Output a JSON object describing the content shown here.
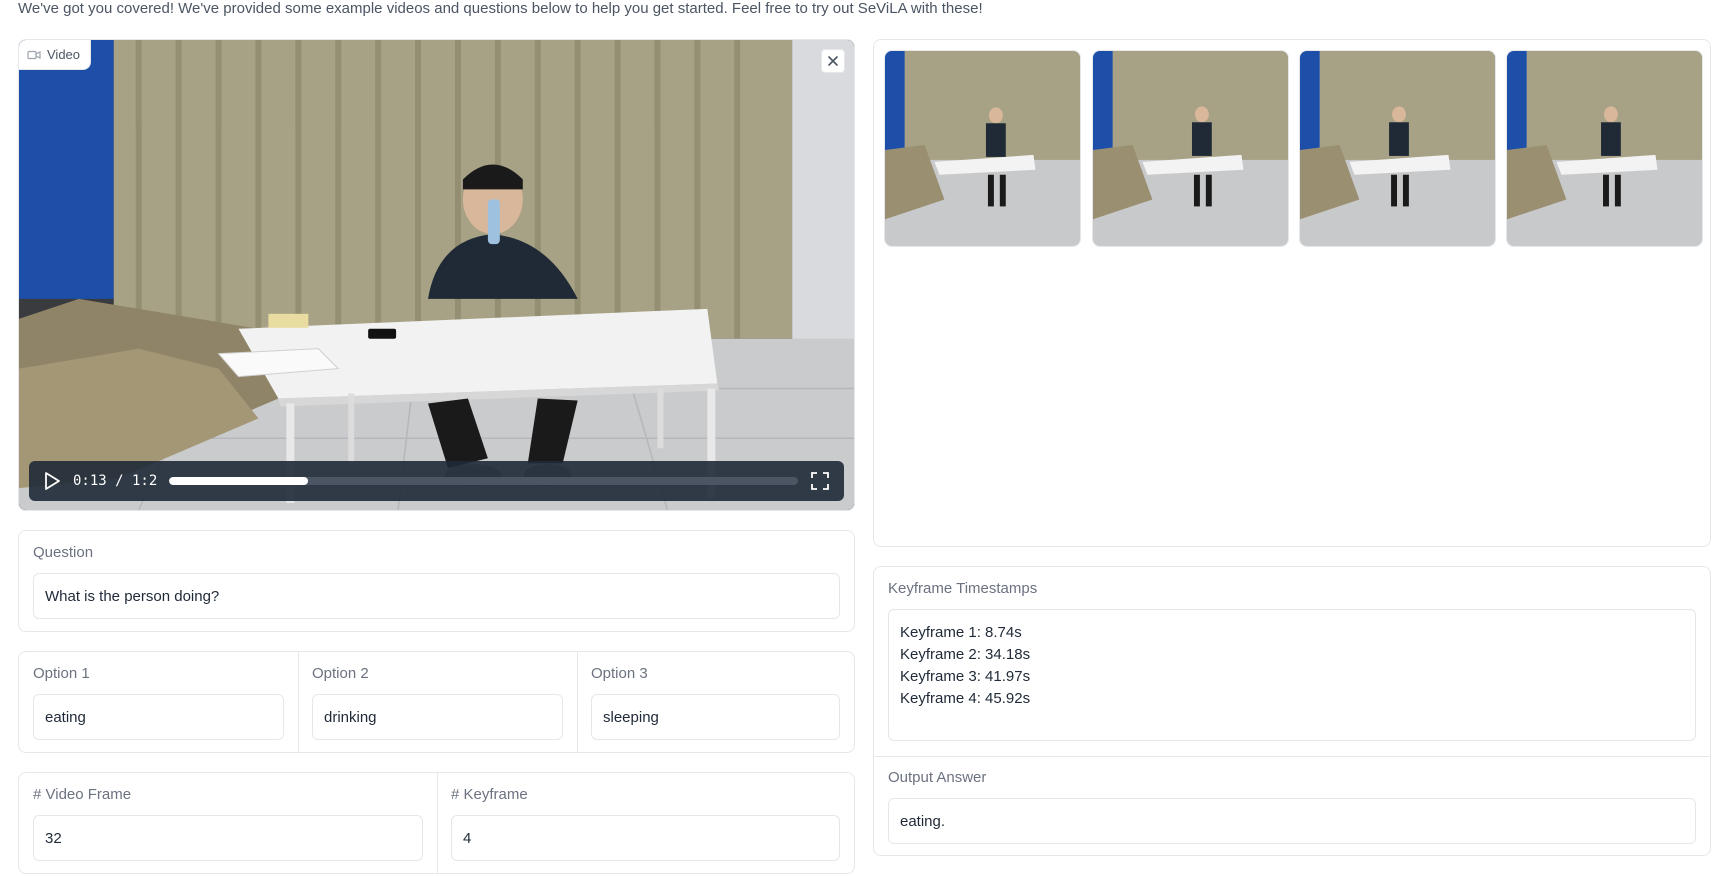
{
  "intro_text": "We've got you covered! We've provided some example videos and questions below to help you get started. Feel free to try out SeViLA with these!",
  "video": {
    "label": "Video",
    "time": "0:13 / 1:2",
    "progress_fraction": 0.22
  },
  "question": {
    "label": "Question",
    "value": "What is the person doing?"
  },
  "options": [
    {
      "label": "Option 1",
      "value": "eating"
    },
    {
      "label": "Option 2",
      "value": "drinking"
    },
    {
      "label": "Option 3",
      "value": "sleeping"
    }
  ],
  "video_frame": {
    "label": "# Video Frame",
    "value": "32"
  },
  "keyframe": {
    "label": "# Keyframe",
    "value": "4"
  },
  "keyframe_timestamps": {
    "label": "Keyframe Timestamps",
    "lines": [
      "Keyframe 1: 8.74s",
      "Keyframe 2: 34.18s",
      "Keyframe 3: 41.97s",
      "Keyframe 4: 45.92s"
    ]
  },
  "output_answer": {
    "label": "Output Answer",
    "value": "eating."
  },
  "icons": [
    "video-camera-icon",
    "close-icon",
    "play-icon",
    "fullscreen-icon"
  ],
  "colors": {
    "border": "#e5e7eb",
    "control_bar": "#1f2937",
    "wall_blue": "#1d4fa8"
  }
}
